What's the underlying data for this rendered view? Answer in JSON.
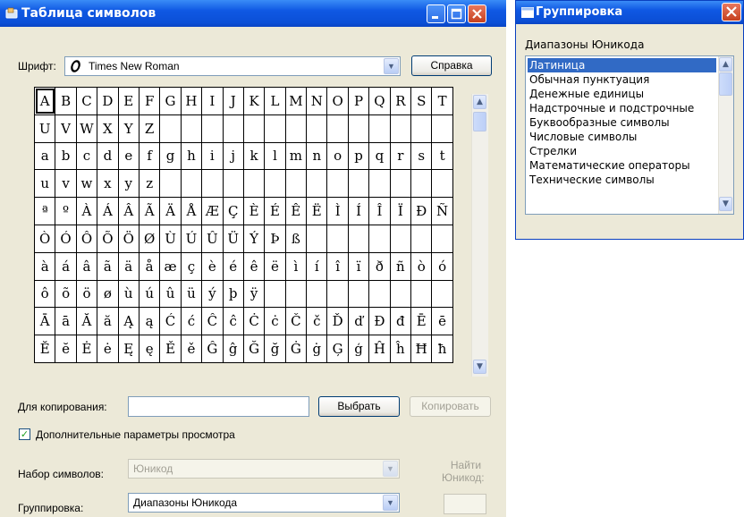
{
  "main_window": {
    "title": "Таблица символов",
    "font_label": "Шрифт:",
    "font_icon": "opentype-icon",
    "font_value": "Times New Roman",
    "help_button": "Справка",
    "copy_label": "Для копирования:",
    "copy_value": "",
    "select_button": "Выбрать",
    "copy_button": "Копировать",
    "advanced_view_label": "Дополнительные параметры просмотра",
    "advanced_view_checked": true,
    "charset_label": "Набор символов:",
    "charset_value": "Юникод",
    "grouping_label": "Группировка:",
    "grouping_value": "Диапазоны Юникода",
    "find_unicode_label_1": "Найти",
    "find_unicode_label_2": "Юникод:",
    "find_unicode_value": ""
  },
  "char_grid": {
    "selected": "A",
    "rows": [
      [
        "A",
        "B",
        "C",
        "D",
        "E",
        "F",
        "G",
        "H",
        "I",
        "J",
        "K",
        "L",
        "M",
        "N",
        "O",
        "P",
        "Q",
        "R",
        "S",
        "T"
      ],
      [
        "U",
        "V",
        "W",
        "X",
        "Y",
        "Z",
        "",
        "",
        "",
        "",
        "",
        "",
        "",
        "",
        "",
        "",
        "",
        "",
        "",
        ""
      ],
      [
        "a",
        "b",
        "c",
        "d",
        "e",
        "f",
        "g",
        "h",
        "i",
        "j",
        "k",
        "l",
        "m",
        "n",
        "o",
        "p",
        "q",
        "r",
        "s",
        "t"
      ],
      [
        "u",
        "v",
        "w",
        "x",
        "y",
        "z",
        "",
        "",
        "",
        "",
        "",
        "",
        "",
        "",
        "",
        "",
        "",
        "",
        "",
        ""
      ],
      [
        "ª",
        "º",
        "À",
        "Á",
        "Â",
        "Ã",
        "Ä",
        "Å",
        "Æ",
        "Ç",
        "È",
        "É",
        "Ê",
        "Ë",
        "Ì",
        "Í",
        "Î",
        "Ï",
        "Ð",
        "Ñ"
      ],
      [
        "Ò",
        "Ó",
        "Ô",
        "Õ",
        "Ö",
        "Ø",
        "Ù",
        "Ú",
        "Û",
        "Ü",
        "Ý",
        "Þ",
        "ß",
        "",
        "",
        "",
        "",
        "",
        "",
        ""
      ],
      [
        "à",
        "á",
        "â",
        "ã",
        "ä",
        "å",
        "æ",
        "ç",
        "è",
        "é",
        "ê",
        "ë",
        "ì",
        "í",
        "î",
        "ï",
        "ð",
        "ñ",
        "ò",
        "ó"
      ],
      [
        "ô",
        "õ",
        "ö",
        "ø",
        "ù",
        "ú",
        "û",
        "ü",
        "ý",
        "þ",
        "ÿ",
        "",
        "",
        "",
        "",
        "",
        "",
        "",
        "",
        ""
      ],
      [
        "Ā",
        "ā",
        "Ă",
        "ă",
        "Ą",
        "ą",
        "Ć",
        "ć",
        "Ĉ",
        "ĉ",
        "Ċ",
        "ċ",
        "Č",
        "č",
        "Ď",
        "ď",
        "Đ",
        "đ",
        "Ē",
        "ē"
      ],
      [
        "Ĕ",
        "ĕ",
        "Ė",
        "ė",
        "Ę",
        "ę",
        "Ě",
        "ě",
        "Ĝ",
        "ĝ",
        "Ğ",
        "ğ",
        "Ġ",
        "ġ",
        "Ģ",
        "ģ",
        "Ĥ",
        "ĥ",
        "Ħ",
        "ħ"
      ]
    ]
  },
  "group_window": {
    "title": "Группировка",
    "list_label": "Диапазоны Юникода",
    "items": [
      "Латиница",
      "Обычная пунктуация",
      "Денежные единицы",
      "Надстрочные и подстрочные",
      "Буквообразные символы",
      "Числовые символы",
      "Стрелки",
      "Математические операторы",
      "Технические символы"
    ],
    "selected_index": 0
  },
  "colors": {
    "title_bar": "#0b4fd6",
    "dialog_bg": "#ece9d8",
    "selection": "#316ac5"
  }
}
